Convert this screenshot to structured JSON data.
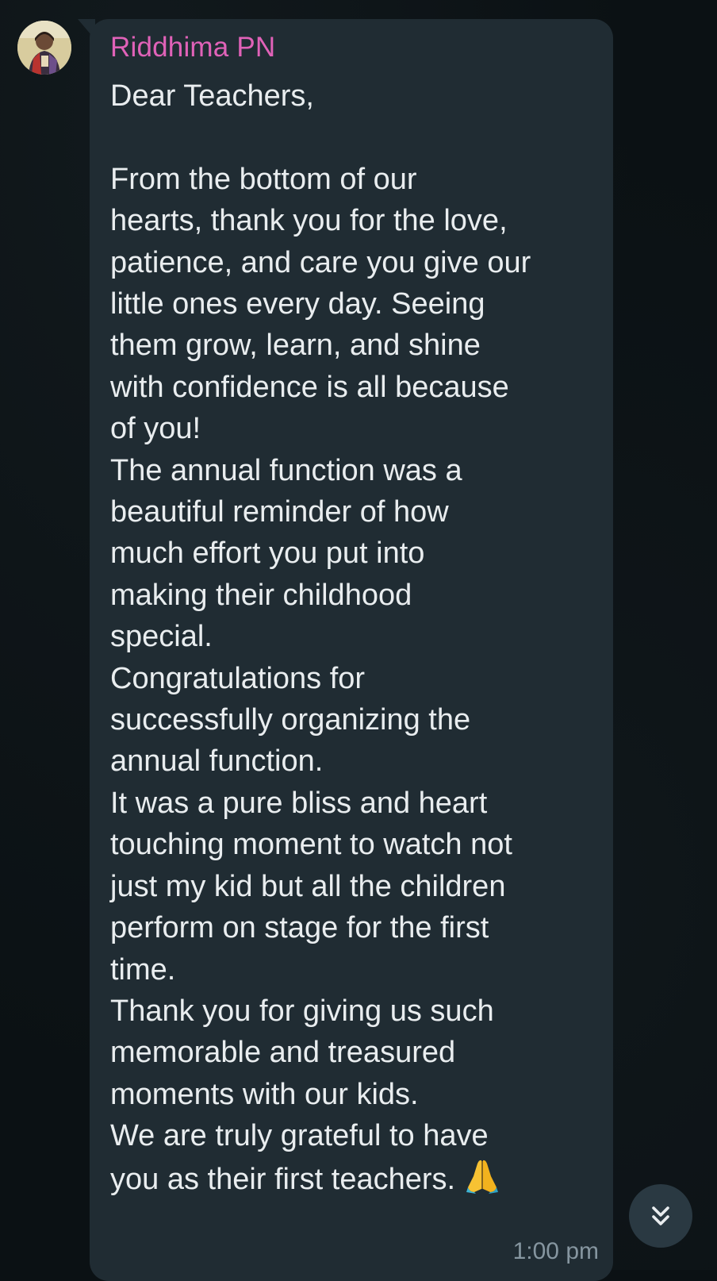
{
  "message": {
    "sender_name": "Riddhima PN",
    "sender_color": "#e062b8",
    "lines": [
      "Dear Teachers,",
      "",
      "From the bottom of our",
      "hearts, thank you for the love,",
      "patience, and care you give our",
      "little ones every day. Seeing",
      "them grow, learn, and shine",
      "with confidence is all because",
      "of you!",
      "The annual function was a",
      "beautiful reminder of how",
      "much effort you put into",
      "making their childhood",
      "special.",
      "Congratulations for",
      "successfully organizing the",
      "annual function.",
      "It was a pure bliss and heart",
      "touching moment to watch not",
      "just my kid but all the children",
      "perform on stage for the first",
      "time.",
      "Thank you for giving us such",
      "memorable and treasured",
      "moments with our kids.",
      "We are truly grateful to have",
      "you as their first teachers."
    ],
    "trailing_emoji": "folded-hands-icon",
    "timestamp": "1:00 pm"
  },
  "controls": {
    "scroll_down_icon": "double-chevron-down-icon"
  },
  "colors": {
    "background": "#0b1114",
    "bubble": "#202c33",
    "text": "#e9edef",
    "timestamp": "#8696a0",
    "scroll_button": "#2a3942"
  }
}
